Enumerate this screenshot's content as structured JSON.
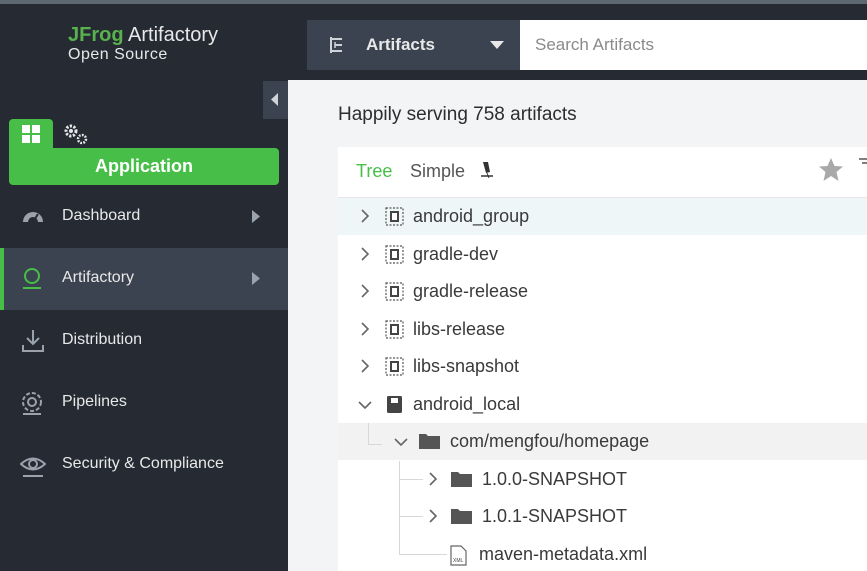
{
  "brand": {
    "name_bold": "JFrog",
    "name_rest": " Artifactory",
    "edition": "Open Source"
  },
  "app_button": "Application",
  "nav": [
    {
      "label": "Dashboard",
      "icon": "gauge-icon",
      "arrow": true
    },
    {
      "label": "Artifactory",
      "icon": "artifactory-icon",
      "arrow": true,
      "active": true
    },
    {
      "label": "Distribution",
      "icon": "download-icon"
    },
    {
      "label": "Pipelines",
      "icon": "pipelines-icon"
    },
    {
      "label": "Security & Compliance",
      "icon": "eye-icon"
    }
  ],
  "topbar": {
    "dropdown": "Artifacts",
    "search_placeholder": "Search Artifacts"
  },
  "main": {
    "title": "Happily serving 758 artifacts"
  },
  "tree": {
    "tabs": {
      "tree": "Tree",
      "simple": "Simple"
    },
    "rows": [
      {
        "label": "android_group",
        "type": "virtual-repo",
        "state": "collapsed",
        "level": 0,
        "selected": true
      },
      {
        "label": "gradle-dev",
        "type": "virtual-repo",
        "state": "collapsed",
        "level": 0
      },
      {
        "label": "gradle-release",
        "type": "virtual-repo",
        "state": "collapsed",
        "level": 0
      },
      {
        "label": "libs-release",
        "type": "virtual-repo",
        "state": "collapsed",
        "level": 0
      },
      {
        "label": "libs-snapshot",
        "type": "virtual-repo",
        "state": "collapsed",
        "level": 0
      },
      {
        "label": "android_local",
        "type": "local-repo",
        "state": "expanded",
        "level": 0
      },
      {
        "label": "com/mengfou/homepage",
        "type": "folder",
        "state": "expanded",
        "level": 1,
        "highlighted": true
      },
      {
        "label": "1.0.0-SNAPSHOT",
        "type": "folder",
        "state": "collapsed",
        "level": 2
      },
      {
        "label": "1.0.1-SNAPSHOT",
        "type": "folder",
        "state": "collapsed",
        "level": 2
      },
      {
        "label": "maven-metadata.xml",
        "type": "xml-file",
        "state": "leaf",
        "level": 2
      }
    ]
  },
  "colors": {
    "accent": "#46be47",
    "sidebar": "#252a33",
    "active_item": "#3c4350"
  }
}
